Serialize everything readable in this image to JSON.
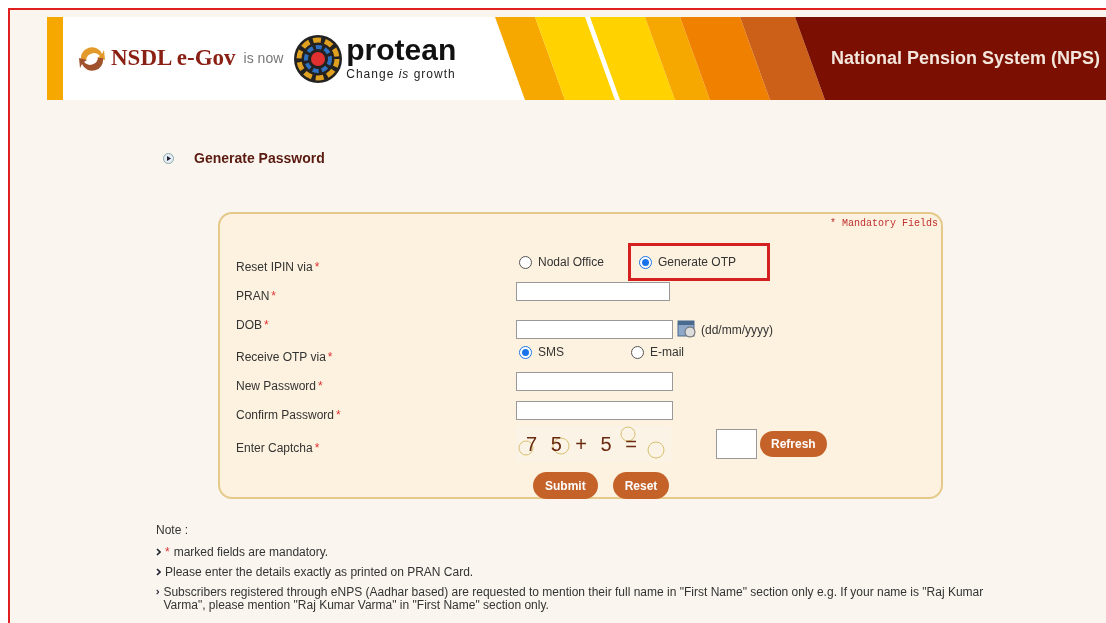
{
  "header": {
    "brand_old": "NSDL e-Gov",
    "connector": "is now",
    "brand_new": "protean",
    "tagline": "Change *is* growth",
    "title": "National Pension System (NPS)"
  },
  "section_title": "Generate Password",
  "form": {
    "mandatory_note": "* Mandatory Fields",
    "fields": [
      {
        "kind": "radio",
        "label": "Reset IPIN via",
        "marker": "*",
        "options": [
          {
            "label": "Nodal Office",
            "selected": false,
            "highlighted": false
          },
          {
            "label": "Generate OTP",
            "selected": true,
            "highlighted": true
          }
        ]
      },
      {
        "kind": "text",
        "label": "PRAN",
        "marker": "*"
      },
      {
        "kind": "date",
        "label": "DOB",
        "marker": "*",
        "hint": "(dd/mm/yyyy)"
      },
      {
        "kind": "radio",
        "label": "Receive OTP via",
        "marker": "*",
        "options": [
          {
            "label": "SMS",
            "selected": true,
            "highlighted": false
          },
          {
            "label": "E-mail",
            "selected": false,
            "highlighted": false
          }
        ]
      },
      {
        "kind": "short",
        "label": "New Password",
        "marker": "*"
      },
      {
        "kind": "short",
        "label": "Confirm Password",
        "marker": "*"
      },
      {
        "kind": "captcha",
        "label": "Enter Captcha",
        "marker": "*",
        "captcha": "7 5 + 5 =",
        "refresh": "Refresh"
      }
    ],
    "buttons": [
      "Submit",
      "Reset"
    ]
  },
  "notes": {
    "title": "Note :",
    "items": [
      {
        "marker": "*",
        "text": "marked fields are mandatory."
      },
      {
        "text": "Please enter the details exactly as printed on PRAN Card."
      },
      {
        "text": "Subscribers registered through eNPS (Aadhar based) are requested to mention their full name in \"First Name\" section only e.g. If your name is \"Raj Kumar Varma\", please mention \"Raj Kumar Varma\" in \"First Name\" section only."
      }
    ]
  }
}
